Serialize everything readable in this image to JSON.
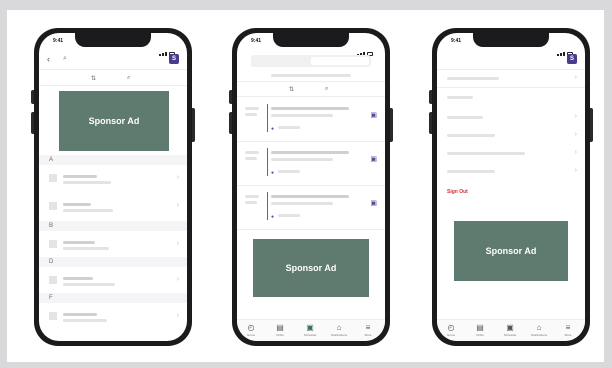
{
  "colors": {
    "ad_bg": "#5f7a6e",
    "accent_purple": "#4b3b8f",
    "sign_out_red": "#d92c2c"
  },
  "status": {
    "time": "9:41"
  },
  "profile_initial": "S",
  "screen1": {
    "back_icon": "chevron-left-icon",
    "ad_label": "Sponsor Ad",
    "sections": [
      "A",
      "B",
      "D",
      "F"
    ]
  },
  "screen2": {
    "ad_label": "Sponsor Ad",
    "nav": [
      "Home",
      "Clubs",
      "Schedule",
      "Notifications",
      "More"
    ]
  },
  "screen3": {
    "sign_out": "Sign Out",
    "ad_label": "Sponsor Ad",
    "nav": [
      "Home",
      "Clubs",
      "Schedule",
      "Notifications",
      "More"
    ]
  }
}
